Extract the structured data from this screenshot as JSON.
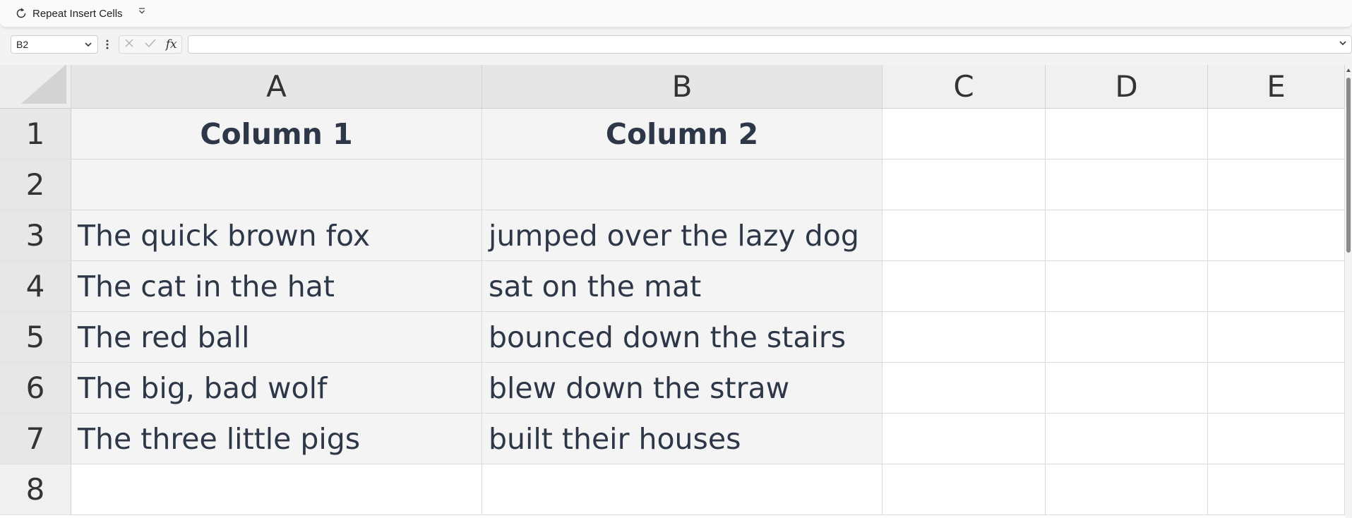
{
  "toolbar": {
    "repeat_label": "Repeat Insert Cells",
    "repeat_icon": "repeat-icon",
    "more_icon": "chevron-down-icon"
  },
  "formula_bar": {
    "name_box": "B2",
    "fx_label": "fx",
    "formula_value": ""
  },
  "grid": {
    "columns": [
      "A",
      "B",
      "C",
      "D",
      "E"
    ],
    "rows": [
      "1",
      "2",
      "3",
      "4",
      "5",
      "6",
      "7",
      "8"
    ],
    "cells": [
      [
        "Column 1",
        "Column 2",
        "",
        "",
        ""
      ],
      [
        "",
        "",
        "",
        "",
        ""
      ],
      [
        "The quick brown fox",
        "jumped over the lazy dog",
        "",
        "",
        ""
      ],
      [
        "The cat in the hat",
        "sat on the mat",
        "",
        "",
        ""
      ],
      [
        "The red ball",
        "bounced down the stairs",
        "",
        "",
        ""
      ],
      [
        "The big, bad wolf",
        "blew down the straw",
        "",
        "",
        ""
      ],
      [
        "The three little pigs",
        "built their houses",
        "",
        "",
        ""
      ],
      [
        "",
        "",
        "",
        "",
        ""
      ]
    ],
    "selection": "A1:B7",
    "active_cell": "B2"
  },
  "colors": {
    "cell_text": "#2d3748",
    "selection_fill": "#f4f4f5",
    "header_fill": "#f0f0f0"
  }
}
